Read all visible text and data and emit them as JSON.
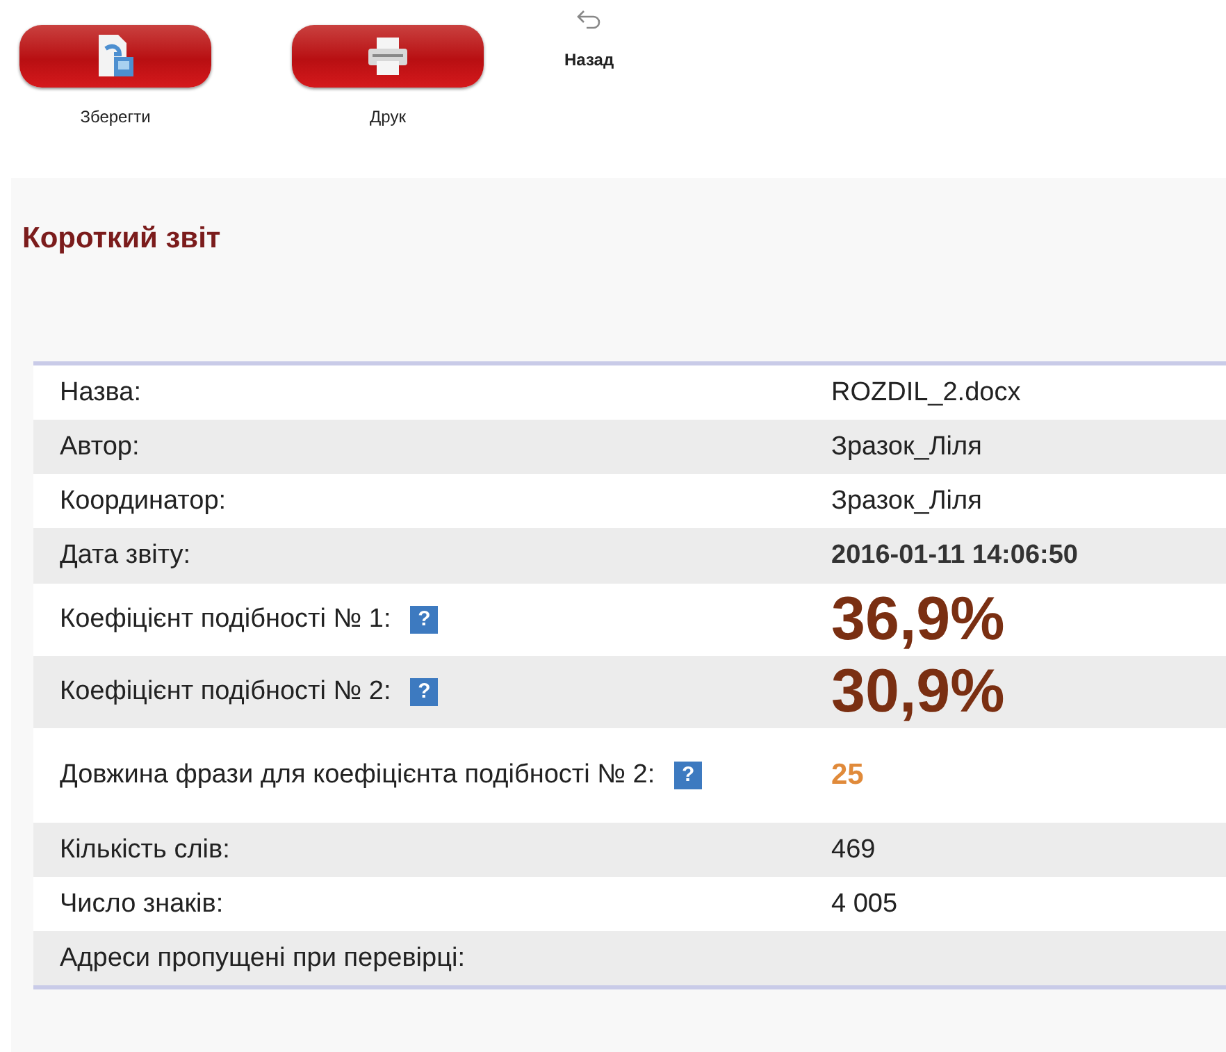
{
  "toolbar": [
    {
      "kind": "save",
      "label": "Зберегти"
    },
    {
      "kind": "print",
      "label": "Друк"
    },
    {
      "kind": "back",
      "label": "Назад"
    }
  ],
  "title": "Короткий звіт",
  "rows": [
    {
      "label": "Назва:",
      "value": "ROZDIL_2.docx",
      "kind": "text"
    },
    {
      "label": "Автор:",
      "value": "Зразок_Ліля",
      "kind": "text"
    },
    {
      "label": "Координатор:",
      "value": "Зразок_Ліля",
      "kind": "text"
    },
    {
      "label": "Дата звіту:",
      "value": "2016-01-11 14:06:50",
      "kind": "bold"
    },
    {
      "label": "Коефіцієнт подібності № 1:",
      "value": "36,9%",
      "kind": "big",
      "help_mark": "?"
    },
    {
      "label": "Коефіцієнт подібності № 2:",
      "value": "30,9%",
      "kind": "big",
      "help_mark": "?"
    },
    {
      "label": "Довжина фрази для коефіцієнта подібності № 2:",
      "value": "25",
      "kind": "accent",
      "help_mark": "?"
    },
    {
      "label": "Кількість слів:",
      "value": "469",
      "kind": "text"
    },
    {
      "label": "Число знаків:",
      "value": "4 005",
      "kind": "text"
    },
    {
      "label": "Адреси пропущені при перевірці:",
      "kind": "text"
    }
  ]
}
